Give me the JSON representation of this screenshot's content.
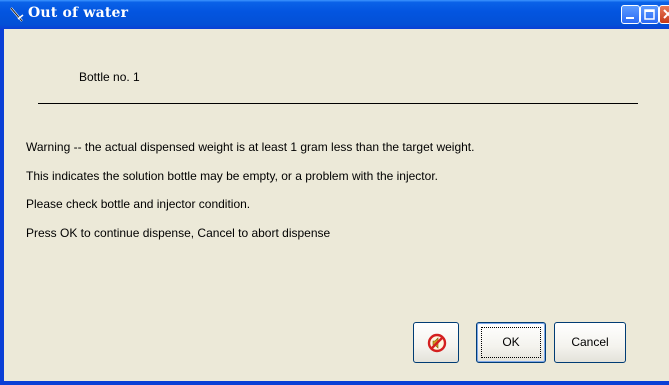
{
  "window": {
    "title": "Out of water",
    "title_icon": "syringe-icon",
    "controls": {
      "minimize_icon": "minimize-icon",
      "maximize_icon": "maximize-icon",
      "close_icon": "close-icon"
    },
    "colors": {
      "titlebar": "#0355e0",
      "frame": "#0a3fd6",
      "client_bg": "#ece9d8"
    }
  },
  "dialog": {
    "bottle_label": "Bottle no. 1",
    "messages": [
      "Warning -- the actual dispensed weight is at least 1 gram less than the target weight.",
      "This indicates the solution bottle may be empty, or a problem with the injector.",
      "Please check bottle and injector condition.",
      "Press OK to continue dispense, Cancel to abort dispense"
    ]
  },
  "buttons": {
    "no_sound_icon": "mute-sound-icon",
    "ok_label": "OK",
    "cancel_label": "Cancel"
  }
}
